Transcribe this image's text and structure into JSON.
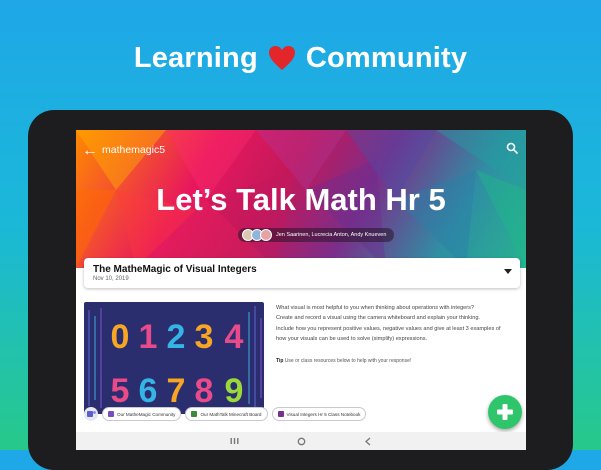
{
  "headline": {
    "left": "Learning",
    "right": "Community"
  },
  "app": {
    "back_glyph": "←",
    "team_handle": "mathemagic5",
    "team_title": "Let’s Talk Math Hr 5",
    "members_text": "Jen Saarinen, Lucrecia Anton, Andy Knueven"
  },
  "post": {
    "title": "The MatheMagic of Visual Integers",
    "date": "Nov 10, 2019",
    "prompt_lines": [
      "What visual is most helpful to you when thinking about operations with integers?",
      "Create and record a visual using the camera whiteboard and explain your thinking.",
      "Include how you represent positive values, negative values and give at least 3 examples of",
      "how your visuals can be used to solve (simplify) expressions."
    ],
    "tip_label": "Tip",
    "tip_text": "Use or class resources below to help with your response!"
  },
  "artwork": {
    "row1": [
      "0",
      "1",
      "2",
      "3",
      "4"
    ],
    "row2": [
      "5",
      "6",
      "7",
      "8",
      "9"
    ]
  },
  "resources": [
    {
      "label": "Our MatheMagic Community",
      "color": "#7a4cc2"
    },
    {
      "label": "Our MathTalk Minecraft Board",
      "color": "#3c8a3c"
    },
    {
      "label": "Visual Integers Hr 5 Class Notebook",
      "color": "#7a2f8f"
    }
  ],
  "icons": {
    "back": "back-arrow-icon",
    "search": "search-icon",
    "dropdown": "chevron-down-icon",
    "add": "plus-icon",
    "nav": [
      "recent-apps-icon",
      "home-icon",
      "back-icon"
    ]
  },
  "colors": {
    "accent_green": "#2fc56b",
    "heart": "#e2262a"
  }
}
